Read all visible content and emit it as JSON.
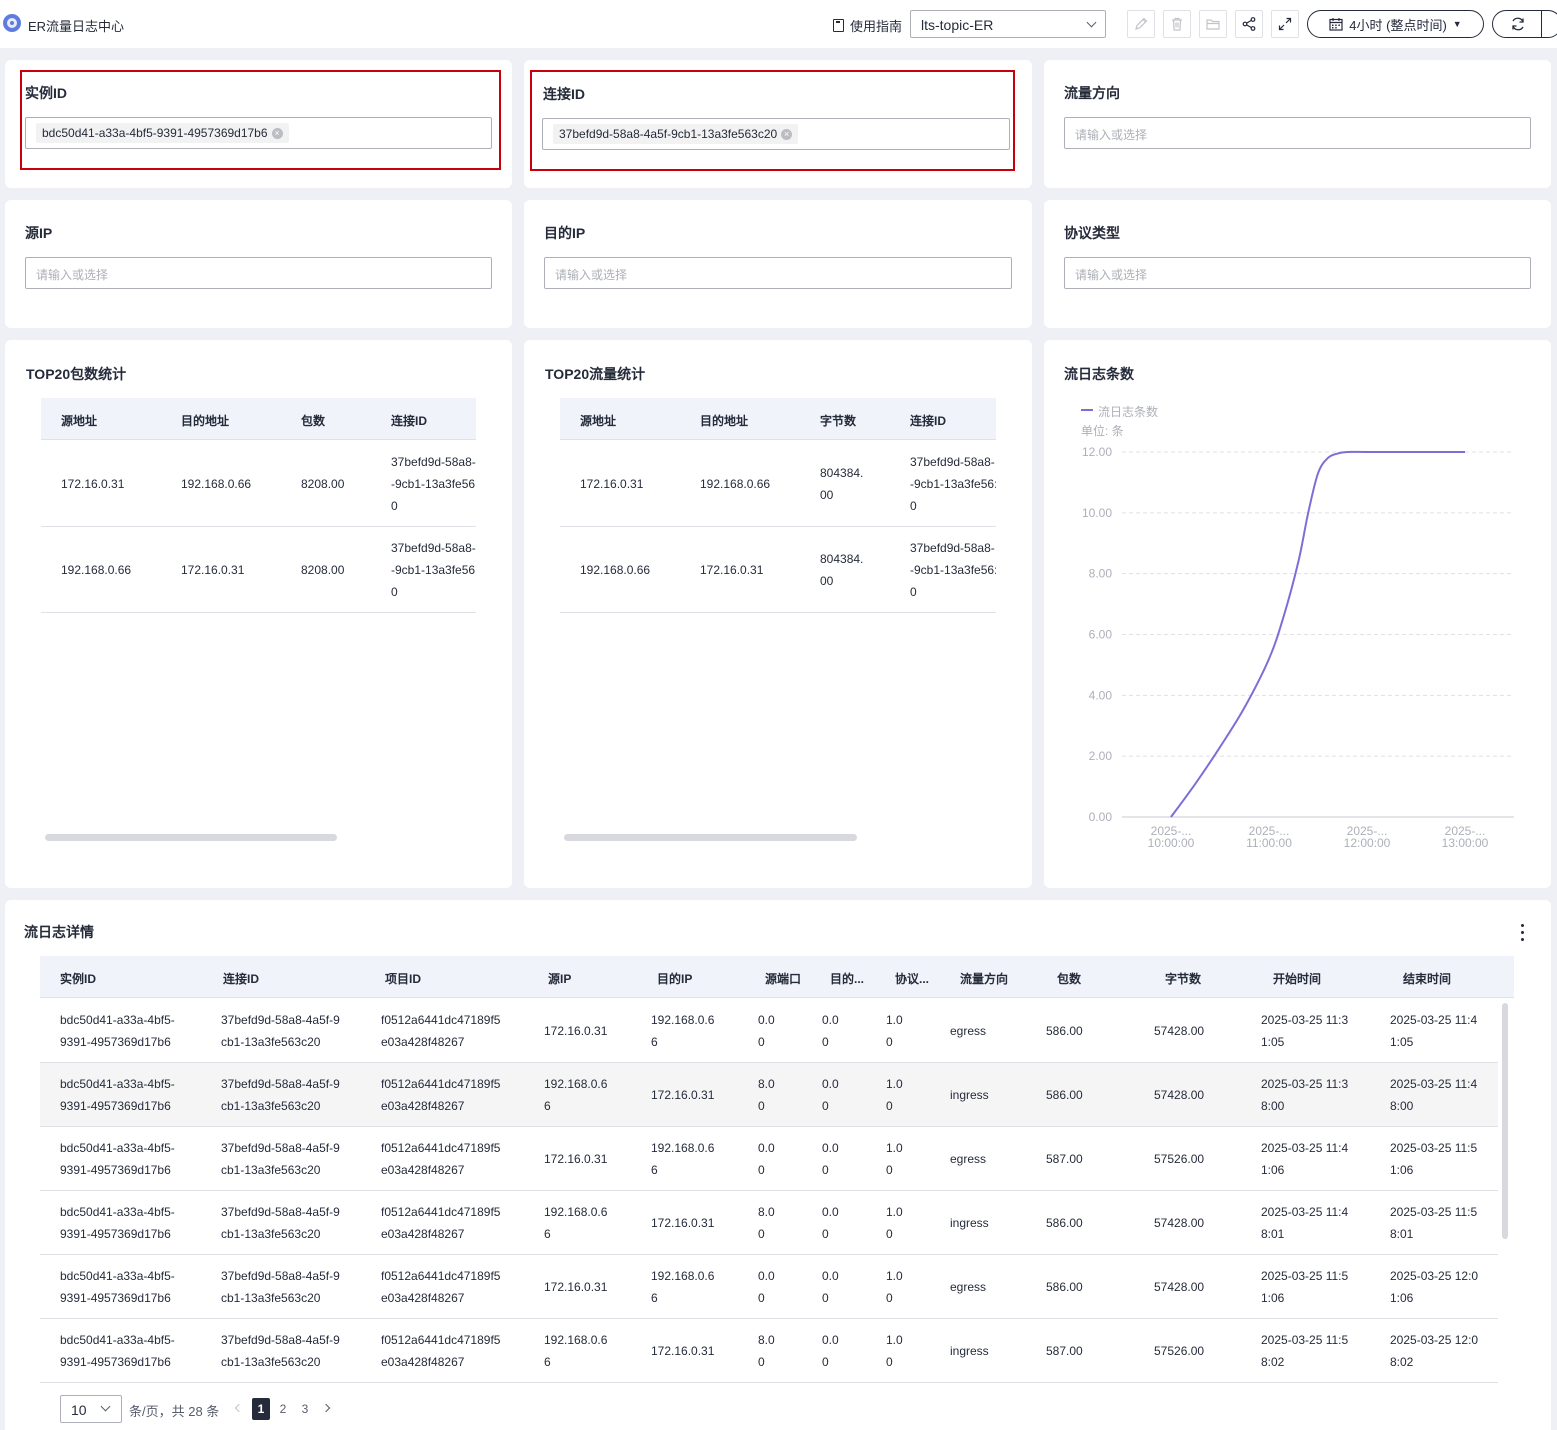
{
  "header": {
    "title": "ER流量日志中心",
    "guide_label": "使用指南",
    "topic_value": "lts-topic-ER",
    "time_range_label": "4小时 (整点时间)"
  },
  "filters": {
    "instance_id": {
      "label": "实例ID",
      "tag": "bdc50d41-a33a-4bf5-9391-4957369d17b6"
    },
    "connection_id": {
      "label": "连接ID",
      "tag": "37befd9d-58a8-4a5f-9cb1-13a3fe563c20"
    },
    "flow_direction": {
      "label": "流量方向",
      "placeholder": "请输入或选择"
    },
    "source_ip": {
      "label": "源IP",
      "placeholder": "请输入或选择"
    },
    "dest_ip": {
      "label": "目的IP",
      "placeholder": "请输入或选择"
    },
    "protocol": {
      "label": "协议类型",
      "placeholder": "请输入或选择"
    }
  },
  "top20_packets": {
    "title": "TOP20包数统计",
    "headers": [
      "源地址",
      "目的地址",
      "包数",
      "连接ID"
    ],
    "rows": [
      {
        "src": "172.16.0.31",
        "dst": "192.168.0.66",
        "value_l1": "8208.00",
        "value_l2": "",
        "conn_l1": "37befd9d-58a8-",
        "conn_l2": "-9cb1-13a3fe56",
        "conn_l3": "0"
      },
      {
        "src": "192.168.0.66",
        "dst": "172.16.0.31",
        "value_l1": "8208.00",
        "value_l2": "",
        "conn_l1": "37befd9d-58a8-",
        "conn_l2": "-9cb1-13a3fe56",
        "conn_l3": "0"
      }
    ]
  },
  "top20_traffic": {
    "title": "TOP20流量统计",
    "headers": [
      "源地址",
      "目的地址",
      "字节数",
      "连接ID"
    ],
    "rows": [
      {
        "src": "172.16.0.31",
        "dst": "192.168.0.66",
        "value_l1": "804384.",
        "value_l2": "00",
        "conn_l1": "37befd9d-58a8-",
        "conn_l2": "-9cb1-13a3fe56:",
        "conn_l3": "0"
      },
      {
        "src": "192.168.0.66",
        "dst": "172.16.0.31",
        "value_l1": "804384.",
        "value_l2": "00",
        "conn_l1": "37befd9d-58a8-",
        "conn_l2": "-9cb1-13a3fe56:",
        "conn_l3": "0"
      }
    ]
  },
  "flow_count_chart": {
    "title": "流日志条数",
    "legend": "流日志条数",
    "unit": "单位: 条"
  },
  "chart_data": {
    "type": "line",
    "title": "流日志条数",
    "ylabel": "单位: 条",
    "ylim": [
      0,
      12
    ],
    "yticks": [
      "0.00",
      "2.00",
      "4.00",
      "6.00",
      "8.00",
      "10.00",
      "12.00"
    ],
    "xticks": [
      {
        "l1": "2025-...",
        "l2": "10:00:00"
      },
      {
        "l1": "2025-...",
        "l2": "11:00:00"
      },
      {
        "l1": "2025-...",
        "l2": "12:00:00"
      },
      {
        "l1": "2025-...",
        "l2": "13:00:00"
      }
    ],
    "grid": true,
    "legend_position": "top-left",
    "color": "#7b6fd6",
    "series": [
      {
        "name": "流日志条数",
        "x": [
          10.0,
          10.25,
          10.5,
          10.75,
          11.0,
          11.15,
          11.3,
          11.4,
          11.5,
          11.6,
          11.7,
          11.8,
          12.0,
          12.5,
          13.0
        ],
        "values": [
          0.0,
          1.1,
          2.3,
          3.6,
          5.2,
          6.6,
          8.4,
          10.0,
          11.3,
          11.8,
          11.95,
          12.0,
          12.0,
          12.0,
          12.0
        ]
      }
    ]
  },
  "flow_details": {
    "title": "流日志详情",
    "headers": [
      "实例ID",
      "连接ID",
      "项目ID",
      "源IP",
      "目的IP",
      "源端口",
      "目的...",
      "协议...",
      "流量方向",
      "包数",
      "字节数",
      "开始时间",
      "结束时间"
    ],
    "rows": [
      {
        "inst1": "bdc50d41-a33a-4bf5-",
        "inst2": "9391-4957369d17b6",
        "conn1": "37befd9d-58a8-4a5f-9",
        "conn2": "cb1-13a3fe563c20",
        "proj1": "f0512a6441dc47189f5",
        "proj2": "e03a428f48267",
        "src1": "172.16.0.31",
        "src2": "",
        "dst1": "192.168.0.6",
        "dst2": "6",
        "sport1": "0.0",
        "sport2": "0",
        "dport1": "0.0",
        "dport2": "0",
        "proto1": "1.0",
        "proto2": "0",
        "dir": "egress",
        "pkts": "586.00",
        "bytes": "57428.00",
        "start1": "2025-03-25 11:3",
        "start2": "1:05",
        "end1": "2025-03-25 11:4",
        "end2": "1:05"
      },
      {
        "inst1": "bdc50d41-a33a-4bf5-",
        "inst2": "9391-4957369d17b6",
        "conn1": "37befd9d-58a8-4a5f-9",
        "conn2": "cb1-13a3fe563c20",
        "proj1": "f0512a6441dc47189f5",
        "proj2": "e03a428f48267",
        "src1": "192.168.0.6",
        "src2": "6",
        "dst1": "172.16.0.31",
        "dst2": "",
        "sport1": "8.0",
        "sport2": "0",
        "dport1": "0.0",
        "dport2": "0",
        "proto1": "1.0",
        "proto2": "0",
        "dir": "ingress",
        "pkts": "586.00",
        "bytes": "57428.00",
        "start1": "2025-03-25 11:3",
        "start2": "8:00",
        "end1": "2025-03-25 11:4",
        "end2": "8:00"
      },
      {
        "inst1": "bdc50d41-a33a-4bf5-",
        "inst2": "9391-4957369d17b6",
        "conn1": "37befd9d-58a8-4a5f-9",
        "conn2": "cb1-13a3fe563c20",
        "proj1": "f0512a6441dc47189f5",
        "proj2": "e03a428f48267",
        "src1": "172.16.0.31",
        "src2": "",
        "dst1": "192.168.0.6",
        "dst2": "6",
        "sport1": "0.0",
        "sport2": "0",
        "dport1": "0.0",
        "dport2": "0",
        "proto1": "1.0",
        "proto2": "0",
        "dir": "egress",
        "pkts": "587.00",
        "bytes": "57526.00",
        "start1": "2025-03-25 11:4",
        "start2": "1:06",
        "end1": "2025-03-25 11:5",
        "end2": "1:06"
      },
      {
        "inst1": "bdc50d41-a33a-4bf5-",
        "inst2": "9391-4957369d17b6",
        "conn1": "37befd9d-58a8-4a5f-9",
        "conn2": "cb1-13a3fe563c20",
        "proj1": "f0512a6441dc47189f5",
        "proj2": "e03a428f48267",
        "src1": "192.168.0.6",
        "src2": "6",
        "dst1": "172.16.0.31",
        "dst2": "",
        "sport1": "8.0",
        "sport2": "0",
        "dport1": "0.0",
        "dport2": "0",
        "proto1": "1.0",
        "proto2": "0",
        "dir": "ingress",
        "pkts": "586.00",
        "bytes": "57428.00",
        "start1": "2025-03-25 11:4",
        "start2": "8:01",
        "end1": "2025-03-25 11:5",
        "end2": "8:01"
      },
      {
        "inst1": "bdc50d41-a33a-4bf5-",
        "inst2": "9391-4957369d17b6",
        "conn1": "37befd9d-58a8-4a5f-9",
        "conn2": "cb1-13a3fe563c20",
        "proj1": "f0512a6441dc47189f5",
        "proj2": "e03a428f48267",
        "src1": "172.16.0.31",
        "src2": "",
        "dst1": "192.168.0.6",
        "dst2": "6",
        "sport1": "0.0",
        "sport2": "0",
        "dport1": "0.0",
        "dport2": "0",
        "proto1": "1.0",
        "proto2": "0",
        "dir": "egress",
        "pkts": "586.00",
        "bytes": "57428.00",
        "start1": "2025-03-25 11:5",
        "start2": "1:06",
        "end1": "2025-03-25 12:0",
        "end2": "1:06"
      },
      {
        "inst1": "bdc50d41-a33a-4bf5-",
        "inst2": "9391-4957369d17b6",
        "conn1": "37befd9d-58a8-4a5f-9",
        "conn2": "cb1-13a3fe563c20",
        "proj1": "f0512a6441dc47189f5",
        "proj2": "e03a428f48267",
        "src1": "192.168.0.6",
        "src2": "6",
        "dst1": "172.16.0.31",
        "dst2": "",
        "sport1": "8.0",
        "sport2": "0",
        "dport1": "0.0",
        "dport2": "0",
        "proto1": "1.0",
        "proto2": "0",
        "dir": "ingress",
        "pkts": "587.00",
        "bytes": "57526.00",
        "start1": "2025-03-25 11:5",
        "start2": "8:02",
        "end1": "2025-03-25 12:0",
        "end2": "8:02"
      }
    ]
  },
  "pagination": {
    "page_size": "10",
    "summary": "条/页，共 28 条",
    "pages": [
      "1",
      "2",
      "3"
    ],
    "current": "1"
  }
}
